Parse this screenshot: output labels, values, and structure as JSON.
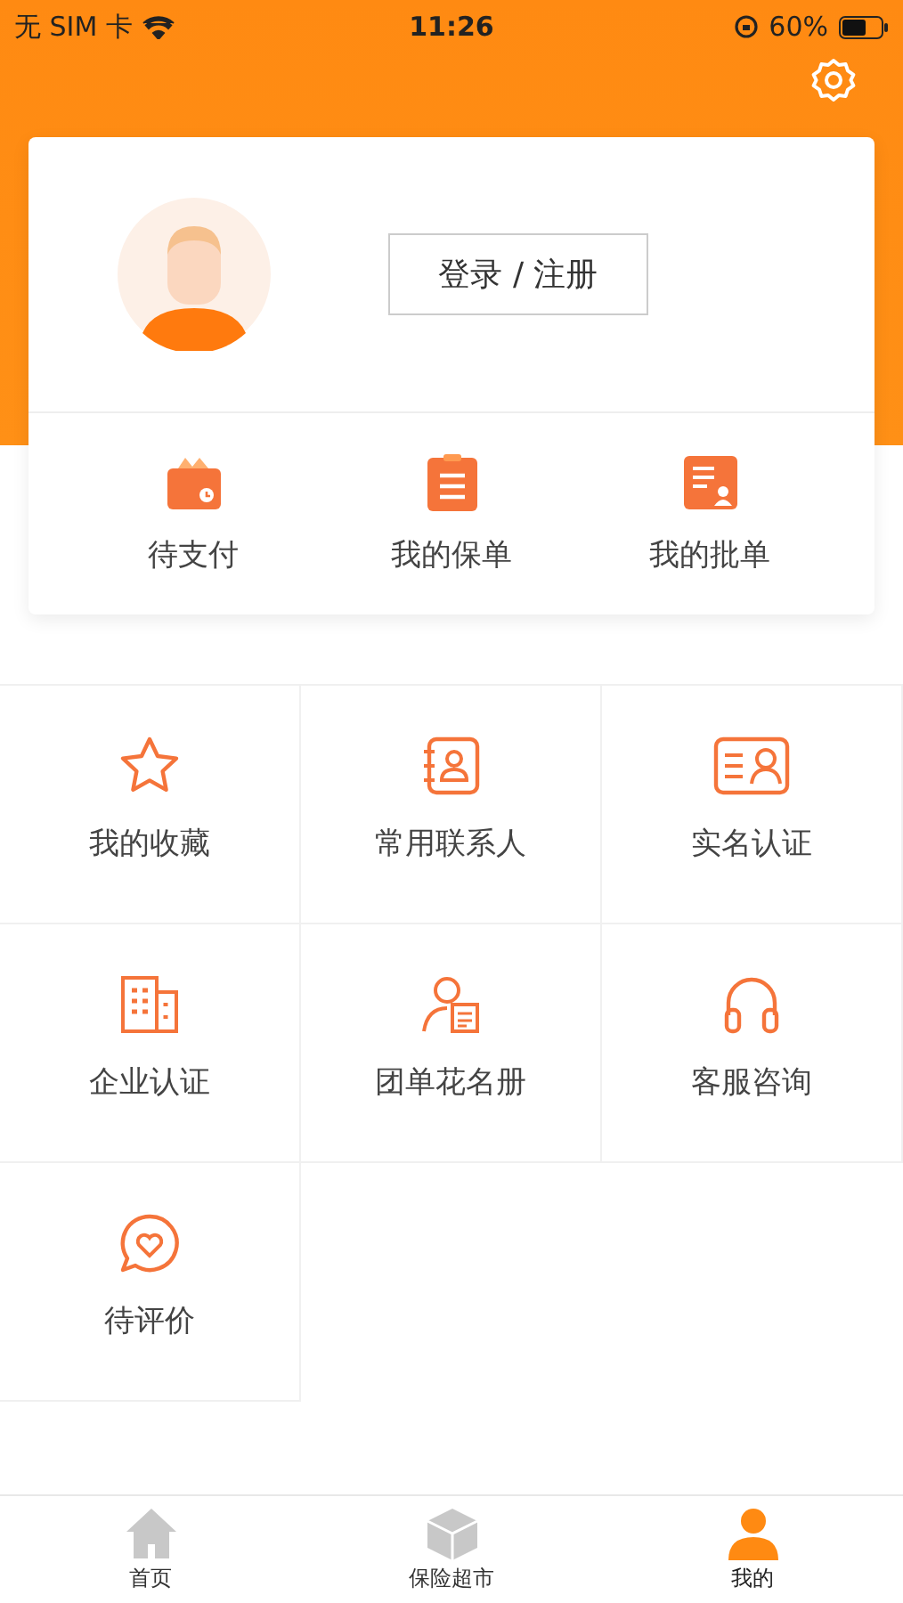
{
  "status_bar": {
    "carrier": "无 SIM 卡",
    "time": "11:26",
    "battery": "60%"
  },
  "profile": {
    "login_button": "登录 / 注册"
  },
  "orders": [
    {
      "label": "待支付",
      "kind": "wallet"
    },
    {
      "label": "我的保单",
      "kind": "clipboard"
    },
    {
      "label": "我的批单",
      "kind": "document"
    }
  ],
  "services": [
    {
      "label": "我的收藏",
      "kind": "star"
    },
    {
      "label": "常用联系人",
      "kind": "contacts"
    },
    {
      "label": "实名认证",
      "kind": "idcard"
    },
    {
      "label": "企业认证",
      "kind": "building"
    },
    {
      "label": "团单花名册",
      "kind": "roster"
    },
    {
      "label": "客服咨询",
      "kind": "headset"
    },
    {
      "label": "待评价",
      "kind": "review"
    }
  ],
  "tab_bar": [
    {
      "label": "首页",
      "kind": "home",
      "selected": false
    },
    {
      "label": "保险超市",
      "kind": "market",
      "selected": false
    },
    {
      "label": "我的",
      "kind": "profile",
      "selected": true
    }
  ]
}
